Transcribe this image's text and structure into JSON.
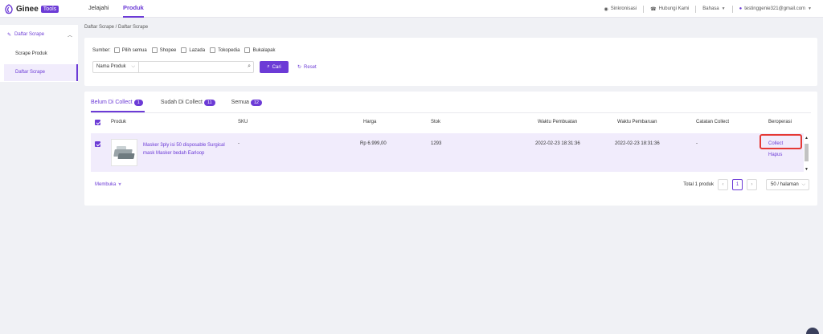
{
  "topbar": {
    "logo_text": "Ginee",
    "logo_badge": "Tools",
    "nav": [
      "Jelajahi",
      "Produk"
    ],
    "right": {
      "sync": "Sinkronisasi",
      "contact": "Hubungi Kami",
      "language": "Bahasa",
      "user": "testinggenie321@gmail.com"
    }
  },
  "sidebar": {
    "group": "Daftar Scrape",
    "items": [
      "Scrape Produk",
      "Daftar Scrape"
    ]
  },
  "breadcrumb": "Daftar Scrape / Daftar Scrape",
  "filter": {
    "source_label": "Sumber:",
    "sources": [
      "Pilih semua",
      "Shopee",
      "Lazada",
      "Tokopedia",
      "Bukalapak"
    ],
    "field_select": "Nama Produk",
    "search_value": "",
    "search_button": "Cari",
    "reset_button": "Reset"
  },
  "tabs": [
    {
      "label": "Belum Di Collect",
      "count": "1"
    },
    {
      "label": "Sudah Di Collect",
      "count": "11"
    },
    {
      "label": "Semua",
      "count": "12"
    }
  ],
  "table": {
    "columns": [
      "Produk",
      "SKU",
      "Harga",
      "Stok",
      "Waktu Pembuatan",
      "Waktu Pembaruan",
      "Catatan Collect",
      "Beroperasi"
    ],
    "rows": [
      {
        "name": "Masker 3ply isi 50 disposable Surgical mask Masker bedah Earloop",
        "sku": "-",
        "price": "Rp 6.999,00",
        "stock": "1293",
        "created": "2022-02-23 18:31:36",
        "updated": "2022-02-23 18:31:36",
        "note": "-",
        "actions": [
          "Collect",
          "Hapus"
        ]
      }
    ]
  },
  "footer": {
    "open_link": "Membuka",
    "total": "Total 1 produk",
    "page": "1",
    "per_page": "50 / halaman"
  },
  "colors": {
    "accent": "#6c3bd6",
    "row_highlight": "#f1ecfc",
    "annotation_box": "#e53935"
  }
}
